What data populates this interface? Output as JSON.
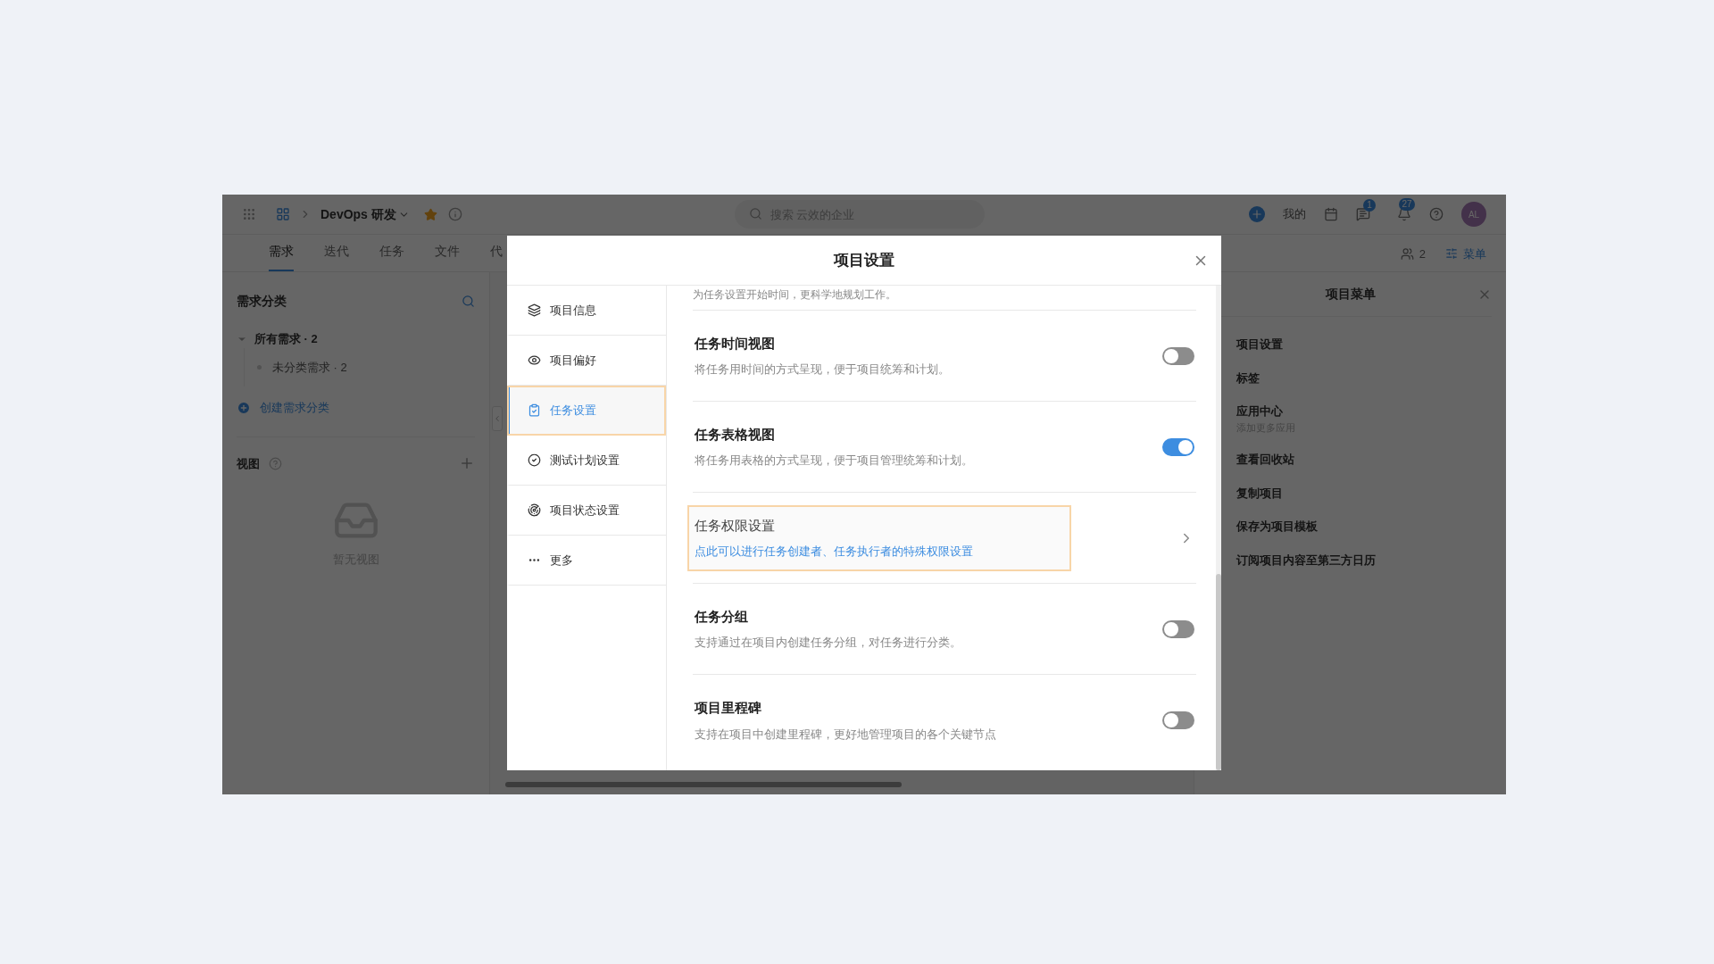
{
  "top_bar": {
    "project": "DevOps 研发",
    "search": {
      "placeholder": "搜索 云效的企业"
    },
    "my_label": "我的",
    "message_badge": "1",
    "notification_badge": "27",
    "avatar": "AL",
    "members": "2",
    "menu_button": "菜单"
  },
  "tabs": [
    {
      "label": "需求",
      "selected": true
    },
    {
      "label": "迭代",
      "selected": false
    },
    {
      "label": "任务",
      "selected": false
    },
    {
      "label": "文件",
      "selected": false
    },
    {
      "label": "代",
      "selected": false
    }
  ],
  "sidebar": {
    "title": "需求分类",
    "tree": [
      {
        "label": "所有需求 · 2",
        "expanded": true,
        "children": [
          {
            "label": "未分类需求 · 2"
          }
        ]
      }
    ],
    "create_link": "创建需求分类",
    "views_title": "视图",
    "views_empty": "暂无视图"
  },
  "project_menu": {
    "title": "项目菜单",
    "items": [
      {
        "label": "项目设置"
      },
      {
        "label": "标签"
      },
      {
        "label": "应用中心",
        "sub": "添加更多应用"
      },
      {
        "label": "查看回收站"
      },
      {
        "label": "复制项目"
      },
      {
        "label": "保存为项目模板"
      },
      {
        "label": "订阅项目内容至第三方日历"
      }
    ]
  },
  "dialog": {
    "title": "项目设置",
    "nav": [
      {
        "label": "项目信息",
        "selected": false,
        "highlighted": false
      },
      {
        "label": "项目偏好",
        "selected": false,
        "highlighted": false
      },
      {
        "label": "任务设置",
        "selected": true,
        "highlighted": true
      },
      {
        "label": "测试计划设置",
        "selected": false,
        "highlighted": false
      },
      {
        "label": "项目状态设置",
        "selected": false,
        "highlighted": false
      },
      {
        "label": "更多",
        "selected": false,
        "highlighted": false
      }
    ],
    "top_text": "为任务设置开始时间，更科学地规划工作。",
    "settings": [
      {
        "kind": "toggle",
        "title": "任务时间视图",
        "description": "将任务用时间的方式呈现，便于项目统筹和计划。",
        "on": false
      },
      {
        "kind": "toggle",
        "title": "任务表格视图",
        "description": "将任务用表格的方式呈现，便于项目管理统筹和计划。",
        "on": true
      },
      {
        "kind": "link",
        "title": "任务权限设置",
        "description": "点此可以进行任务创建者、任务执行者的特殊权限设置",
        "highlighted": true
      },
      {
        "kind": "toggle",
        "title": "任务分组",
        "description": "支持通过在项目内创建任务分组，对任务进行分类。",
        "on": false
      },
      {
        "kind": "toggle",
        "title": "项目里程碑",
        "description": "支持在项目中创建里程碑，更好地管理项目的各个关键节点",
        "on": false
      }
    ]
  }
}
